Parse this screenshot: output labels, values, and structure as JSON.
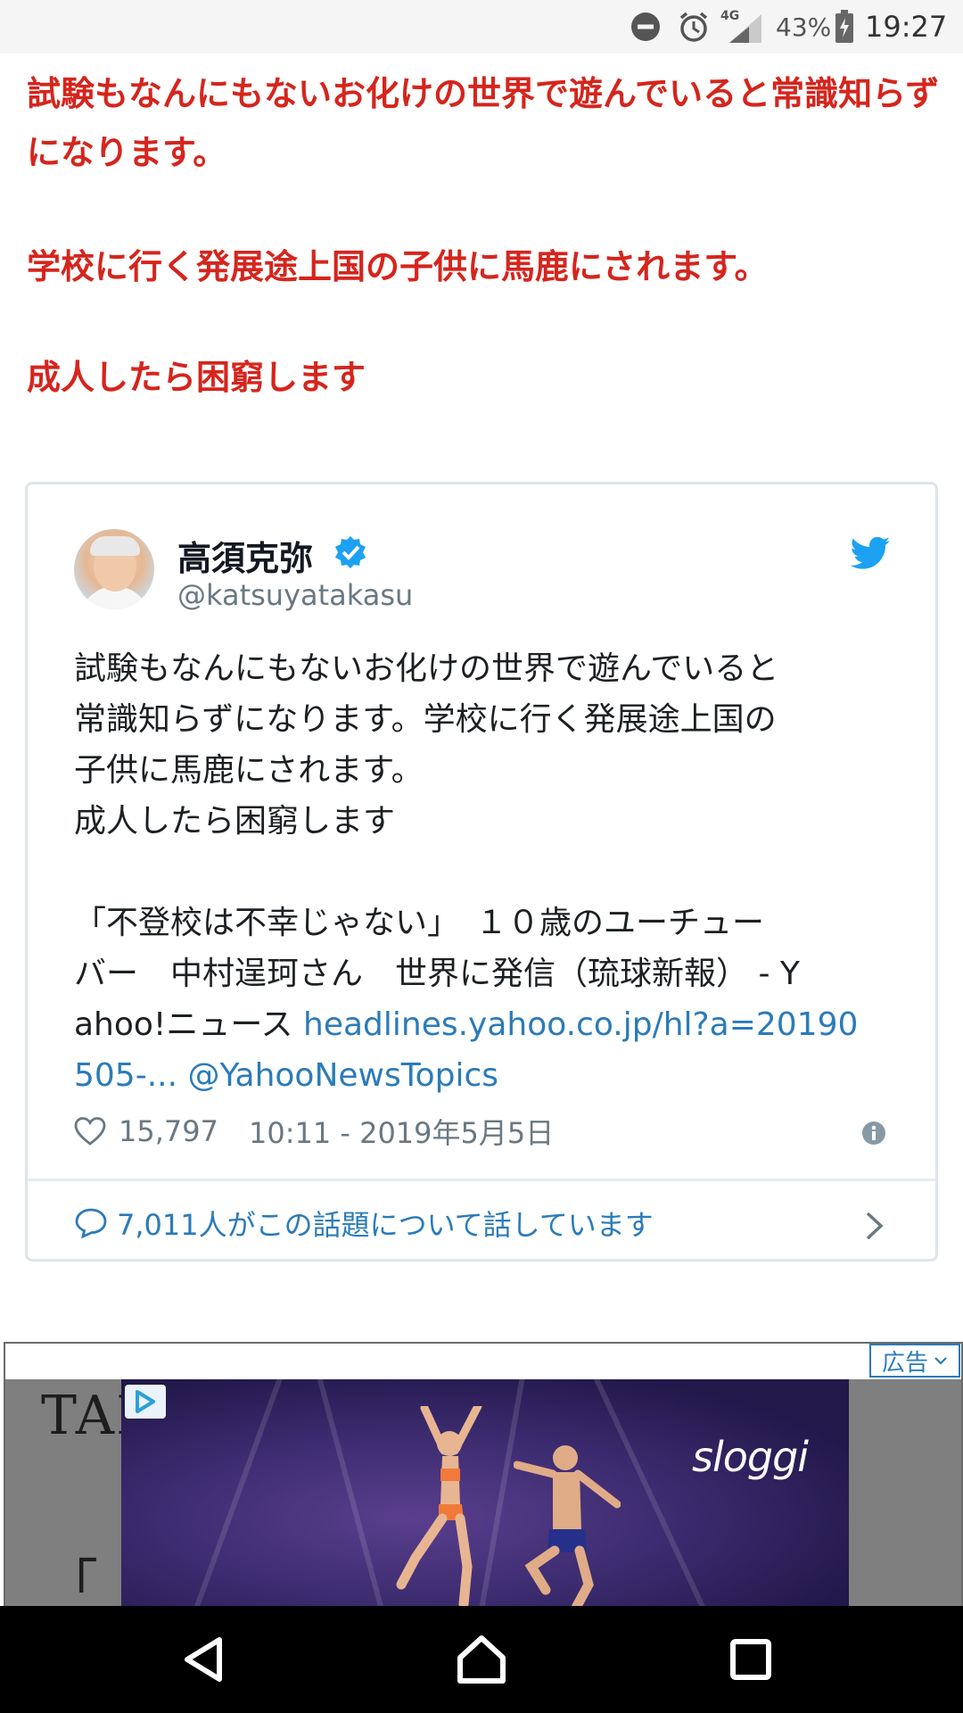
{
  "status_bar": {
    "network": "4G",
    "battery": "43%",
    "time": "19:27",
    "icons": [
      "do-not-disturb-icon",
      "alarm-icon",
      "signal-icon",
      "battery-charging-icon"
    ]
  },
  "article": {
    "paragraphs": [
      "試験もなんにもないお化けの世界で遊んでいると常識知らずになります。",
      "学校に行く発展途上国の子供に馬鹿にされます。",
      "成人したら困窮します"
    ],
    "accent_color": "#d5251d"
  },
  "tweet": {
    "name": "高須克弥",
    "handle": "@katsuyatakasu",
    "body_lines": [
      "試験もなんにもないお化けの世界で遊んでいると",
      "常識知らずになります。学校に行く発展途上国の",
      "子供に馬鹿にされます。",
      "成人したら困窮します"
    ],
    "news_line_1": "「不登校は不幸じゃない」　１０歳のユーチュー",
    "news_line_2": "バー　中村逞珂さん　世界に発信（琉球新報） - Y",
    "news_line_3_prefix": "ahoo!ニュース ",
    "link_part_1": "headlines.yahoo.co.jp/hl?a=20190",
    "link_part_2": "505-...",
    "mention": "@YahooNewsTopics",
    "likes": "15,797",
    "timestamp": "10:11 - 2019年5月5日",
    "conversation": "7,011人がこの話題について話しています",
    "link_color": "#2b7bb9"
  },
  "ad": {
    "label": "広告",
    "brand": "sloggi",
    "underlay_text": "TAI",
    "underlay_bracket": "「"
  },
  "nav_bar": {
    "buttons": [
      "back-icon",
      "home-icon",
      "recents-icon"
    ]
  }
}
